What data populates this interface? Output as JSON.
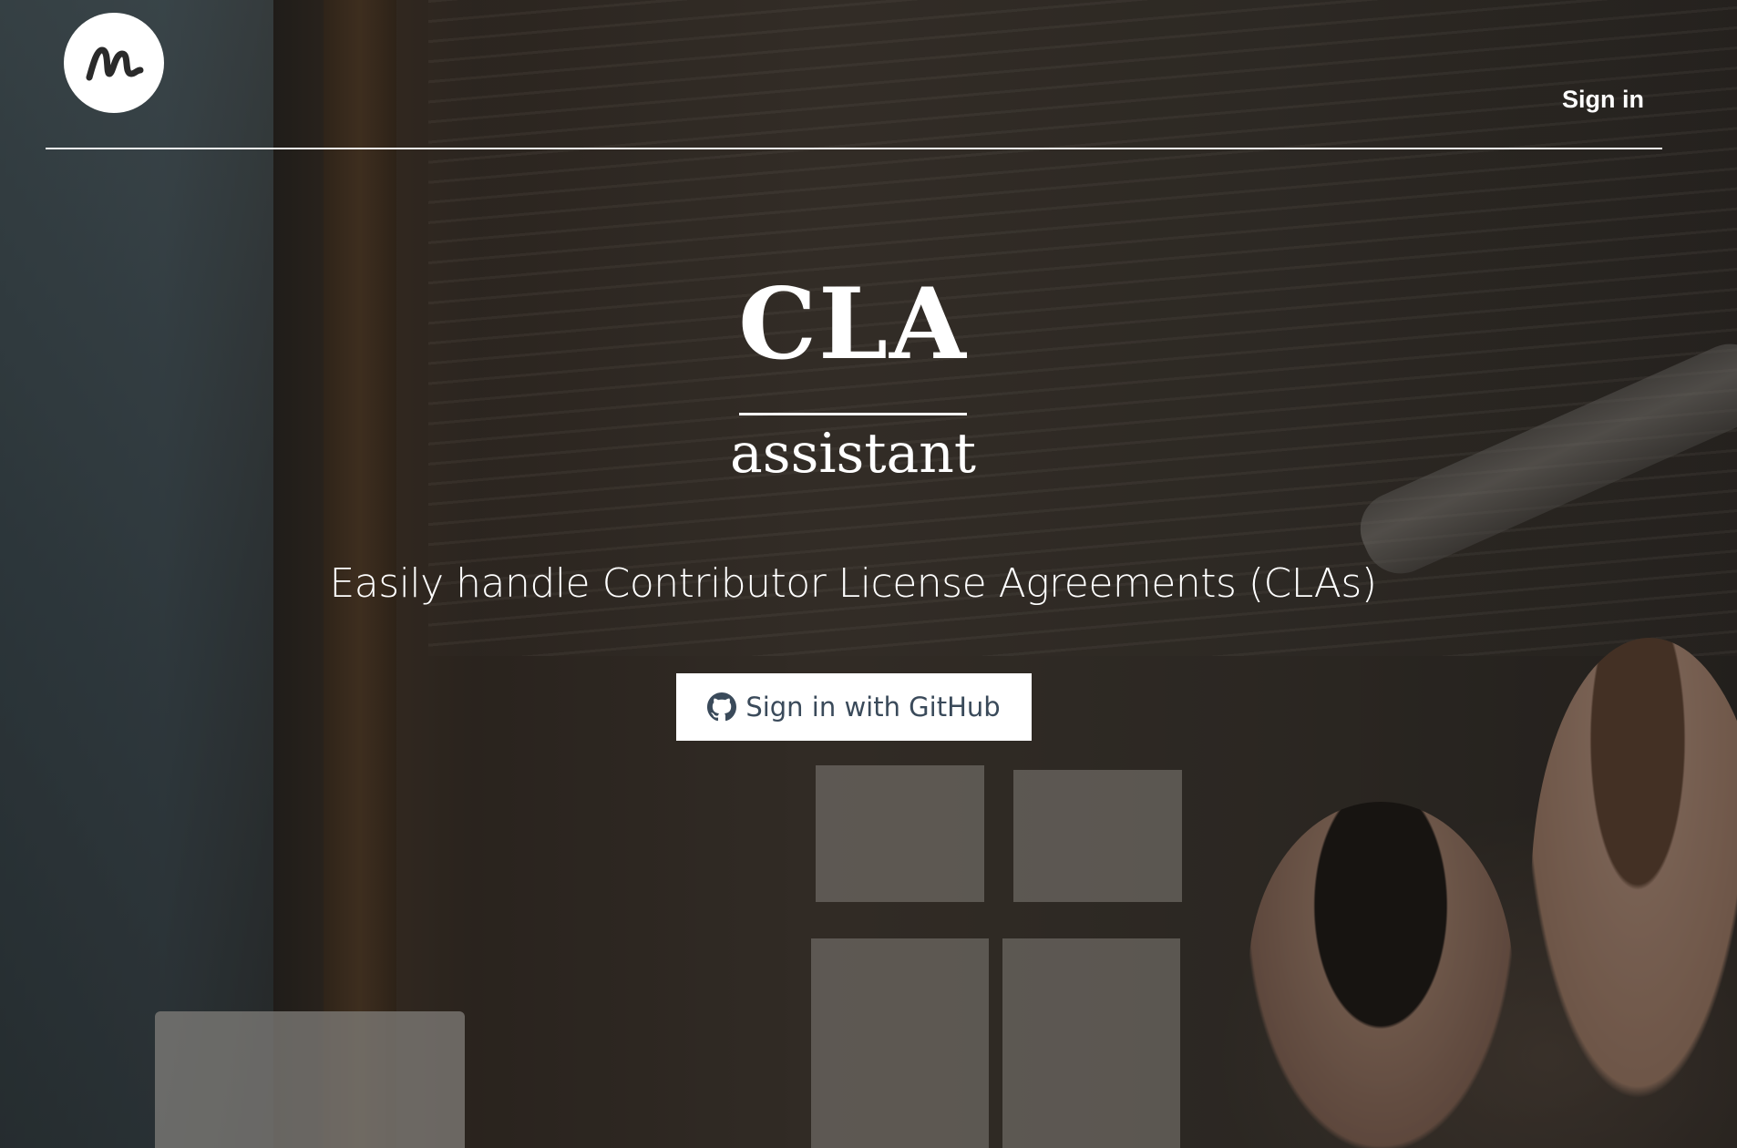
{
  "header": {
    "logo_icon": "cla-assistant-logo-icon",
    "signin_label": "Sign in"
  },
  "hero": {
    "title": "CLA",
    "subtitle": "assistant",
    "tagline": "Easily handle Contributor License Agreements (CLAs)",
    "github_button": {
      "icon": "github-icon",
      "label": "Sign in with GitHub"
    }
  },
  "colors": {
    "text": "#ffffff",
    "button_bg": "#ffffff",
    "button_text": "#3a4a5a"
  }
}
